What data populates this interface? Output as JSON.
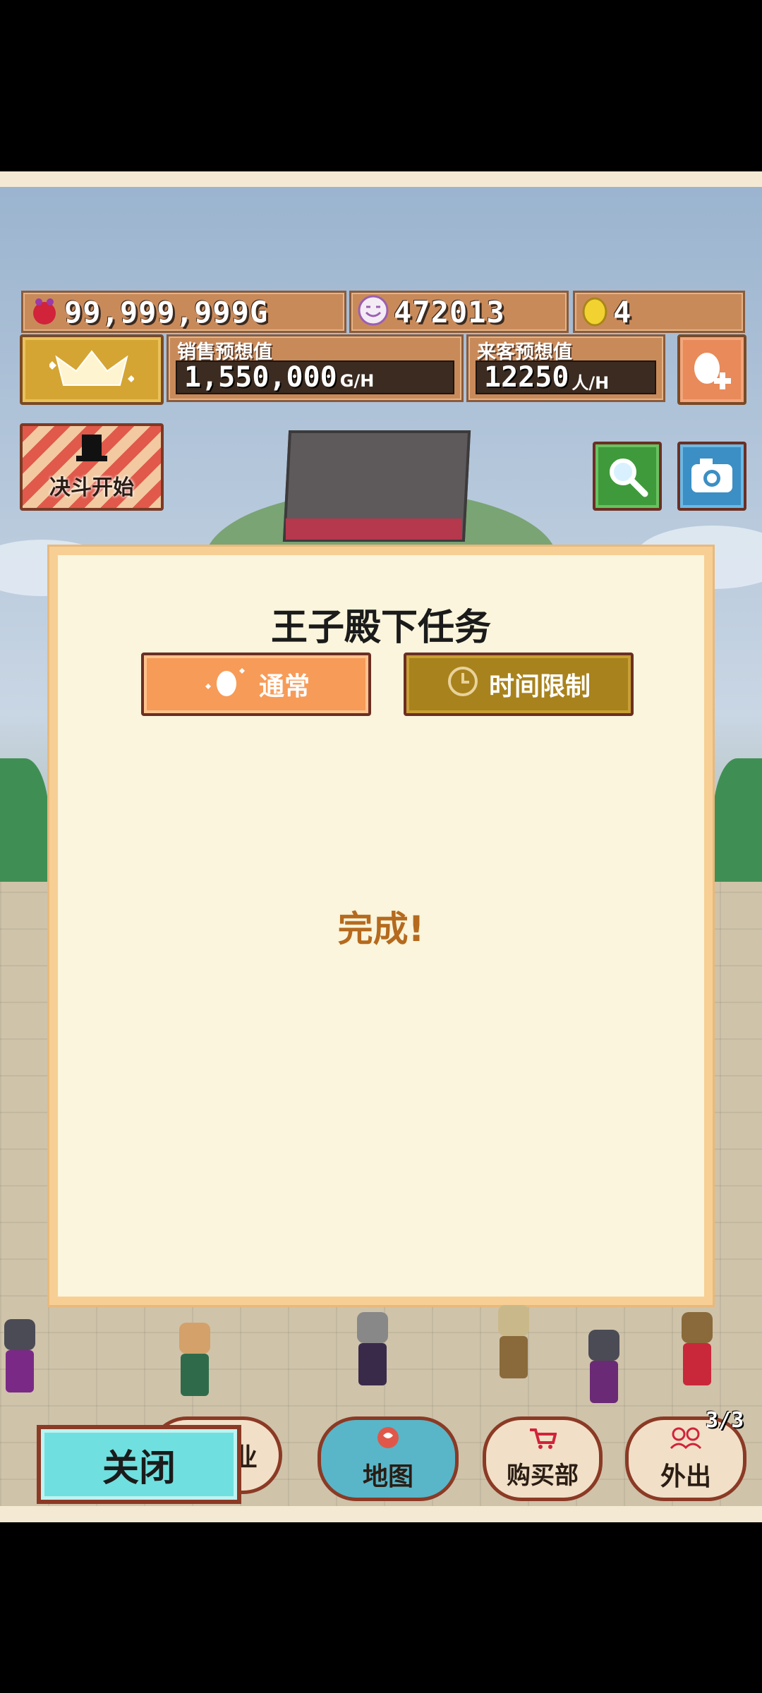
{
  "stats": {
    "gold": "99,999,999G",
    "customers": "472013",
    "eggs": "4"
  },
  "forecast": {
    "sales_label": "销售预想值",
    "sales_value": "1,550,000",
    "sales_unit": "G/H",
    "visitors_label": "来客预想值",
    "visitors_value": "12250",
    "visitors_unit": "人/H"
  },
  "buttons": {
    "duel": "决斗开始"
  },
  "dialog": {
    "title": "王子殿下任务",
    "tab_normal": "通常",
    "tab_limited": "时间限制",
    "status": "完成!"
  },
  "nav": {
    "close": "关闭",
    "hidden_partial": "业",
    "map": "地图",
    "shop": "购买部",
    "outing": "外出",
    "party_count": "3/3"
  },
  "colors": {
    "dialog_bg": "#faf5dc",
    "tab_active": "#f79b58",
    "tab_inactive": "#a8821c",
    "complete_text": "#b56a1e",
    "close_button": "#6fe0df"
  },
  "icons": [
    "purse-icon",
    "smiley-icon",
    "egg-icon",
    "crown-icon",
    "egg-plus-icon",
    "top-hat-icon",
    "magnifier-icon",
    "camera-icon",
    "clock-icon",
    "cart-icon"
  ]
}
